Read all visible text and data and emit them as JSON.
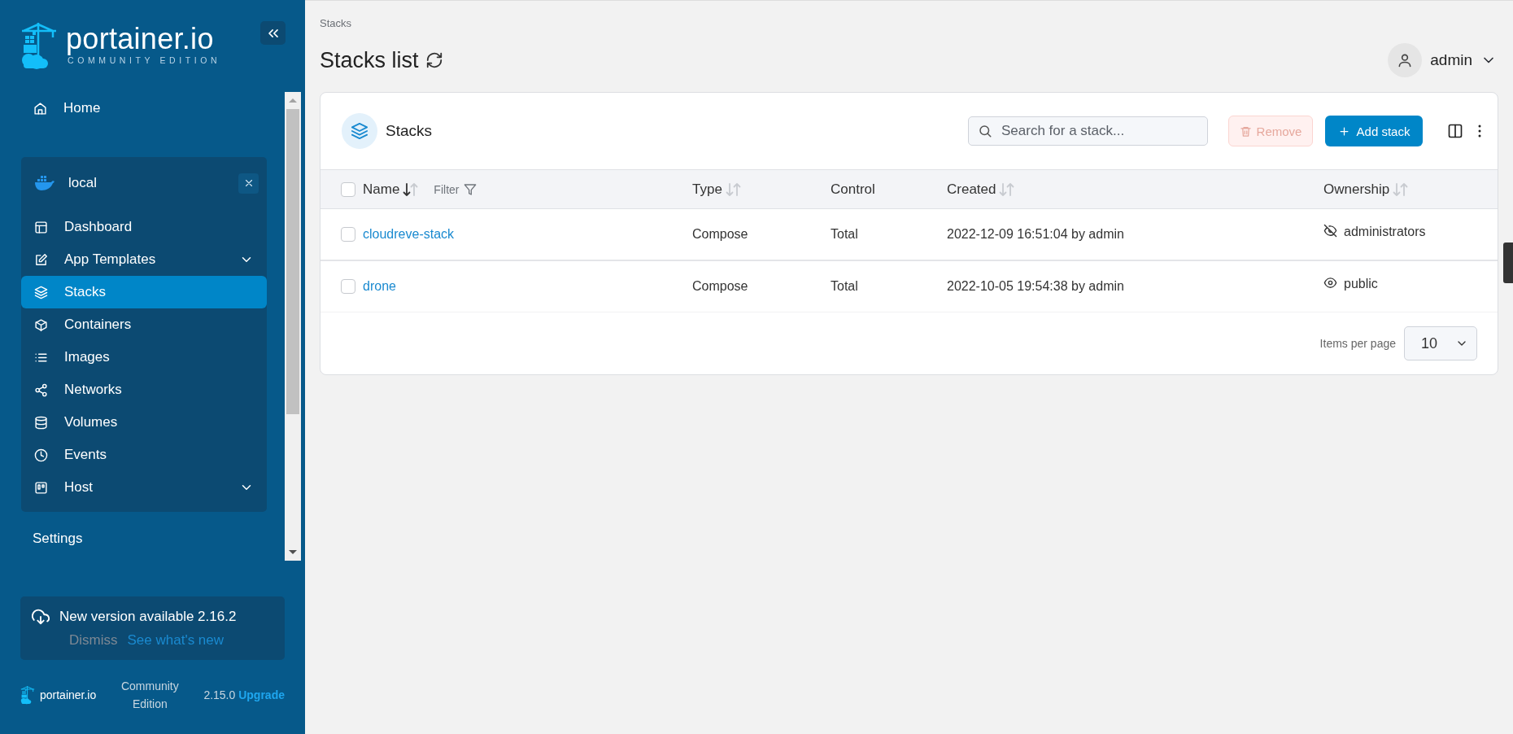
{
  "sidebar": {
    "logo": {
      "name": "portainer.io",
      "edition": "COMMUNITY EDITION"
    },
    "home": {
      "label": "Home"
    },
    "environment": {
      "name": "local",
      "items": [
        {
          "label": "Dashboard",
          "selected": false
        },
        {
          "label": "App Templates",
          "selected": false,
          "expanded": false
        },
        {
          "label": "Stacks",
          "selected": true
        },
        {
          "label": "Containers",
          "selected": false
        },
        {
          "label": "Images",
          "selected": false
        },
        {
          "label": "Networks",
          "selected": false
        },
        {
          "label": "Volumes",
          "selected": false
        },
        {
          "label": "Events",
          "selected": false
        },
        {
          "label": "Host",
          "selected": false,
          "expanded": false
        }
      ]
    },
    "section_heading": "Settings",
    "update": {
      "message": "New version available 2.16.2",
      "dismiss": "Dismiss",
      "link": "See what's new"
    },
    "footer": {
      "brand": "portainer.io",
      "edition": "Community Edition",
      "version": "2.15.0",
      "upgrade": "Upgrade"
    }
  },
  "breadcrumb": "Stacks",
  "page_title": "Stacks list",
  "user": {
    "name": "admin"
  },
  "table": {
    "title": "Stacks",
    "search": {
      "placeholder": "Search for a stack..."
    },
    "remove_button": {
      "label": "Remove",
      "disabled": true
    },
    "add_button": {
      "label": "Add stack"
    },
    "select_all": {
      "checked": false
    },
    "columns": [
      {
        "label": "Name",
        "sorted": true,
        "filter": "Filter"
      },
      {
        "label": "Type",
        "sorted": false
      },
      {
        "label": "Control"
      },
      {
        "label": "Created",
        "sorted": false
      },
      {
        "label": "Ownership",
        "sorted": false
      }
    ],
    "rows": [
      {
        "selected": false,
        "name": "cloudreve-stack",
        "type": "Compose",
        "control": "Total",
        "created": "2022-12-09 16:51:04 by admin",
        "ownership": "administrators",
        "kind": "restricted"
      },
      {
        "selected": false,
        "name": "drone",
        "type": "Compose",
        "control": "Total",
        "created": "2022-10-05 19:54:38 by admin",
        "ownership": "public",
        "kind": "public"
      }
    ],
    "pagination": {
      "label": "Items per page",
      "value": "10"
    }
  }
}
